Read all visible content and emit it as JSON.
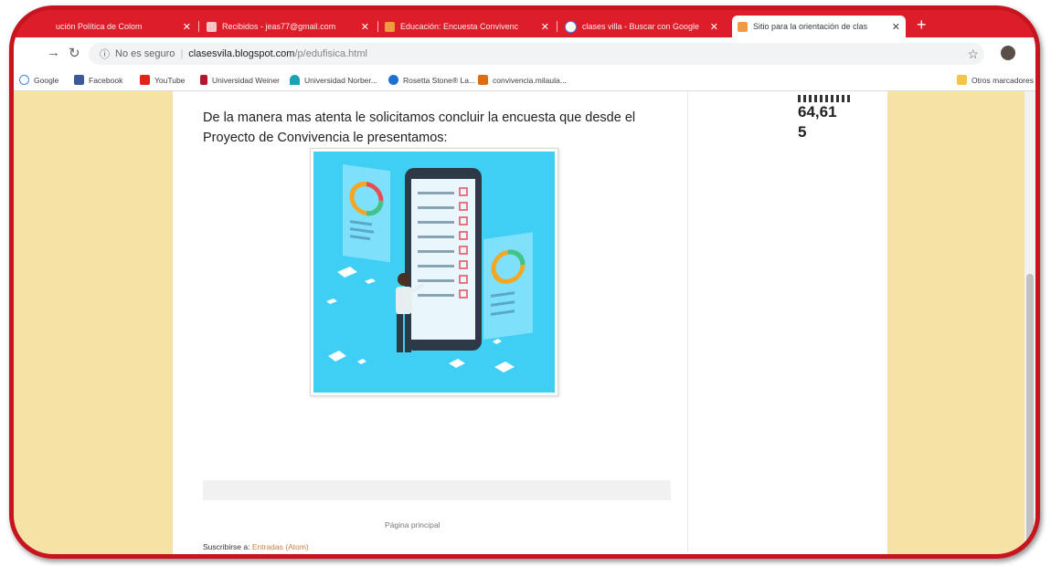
{
  "tabs": [
    {
      "label": "ución Política de Colom",
      "color": "#dd1d2a",
      "favicon": "doc-icon"
    },
    {
      "label": "Recibidos - jeas77@gmail.com",
      "color": "#f6c3c5",
      "favicon": "gmail-icon"
    },
    {
      "label": "Educación: Encuesta Convivenc",
      "color": "#f29a42",
      "favicon": "blogger-icon"
    },
    {
      "label": "clases villa - Buscar con Google",
      "color": "#4285f4",
      "favicon": "google-icon"
    },
    {
      "label": "Sitio para la orientación de clas",
      "color": "#f29a42",
      "favicon": "blogger-icon",
      "active": true
    }
  ],
  "address_bar": {
    "security": "No es seguro",
    "domain": "clasesvila.blogspot.com",
    "path": "/p/edufisica.html"
  },
  "bookmarks": [
    {
      "label": "Google",
      "color": "#4285f4"
    },
    {
      "label": "Facebook",
      "color": "#3b5998"
    },
    {
      "label": "YouTube",
      "color": "#e62117"
    },
    {
      "label": "Universidad Weiner",
      "color": "#b2182b"
    },
    {
      "label": "Universidad Norber...",
      "color": "#19a3b5"
    },
    {
      "label": "Rosetta Stone® La...",
      "color": "#1d6fd0"
    },
    {
      "label": "convivencia.milaula...",
      "color": "#e06c10"
    }
  ],
  "other_bookmarks": "Otros marcadores",
  "page": {
    "intro": "De la manera mas atenta le solicitamos concluir la encuesta que desde el Proyecto de Convivencia le presentamos:",
    "stats_line1": "64,61",
    "stats_line2": "5",
    "home_link": "Página principal",
    "subscribe_prefix": "Suscribirse a: ",
    "subscribe_link": "Entradas (Atom)"
  },
  "colors": {
    "frame": "#c8141e",
    "background": "#f7e2a6",
    "illustration_bg": "#3fcff5"
  }
}
